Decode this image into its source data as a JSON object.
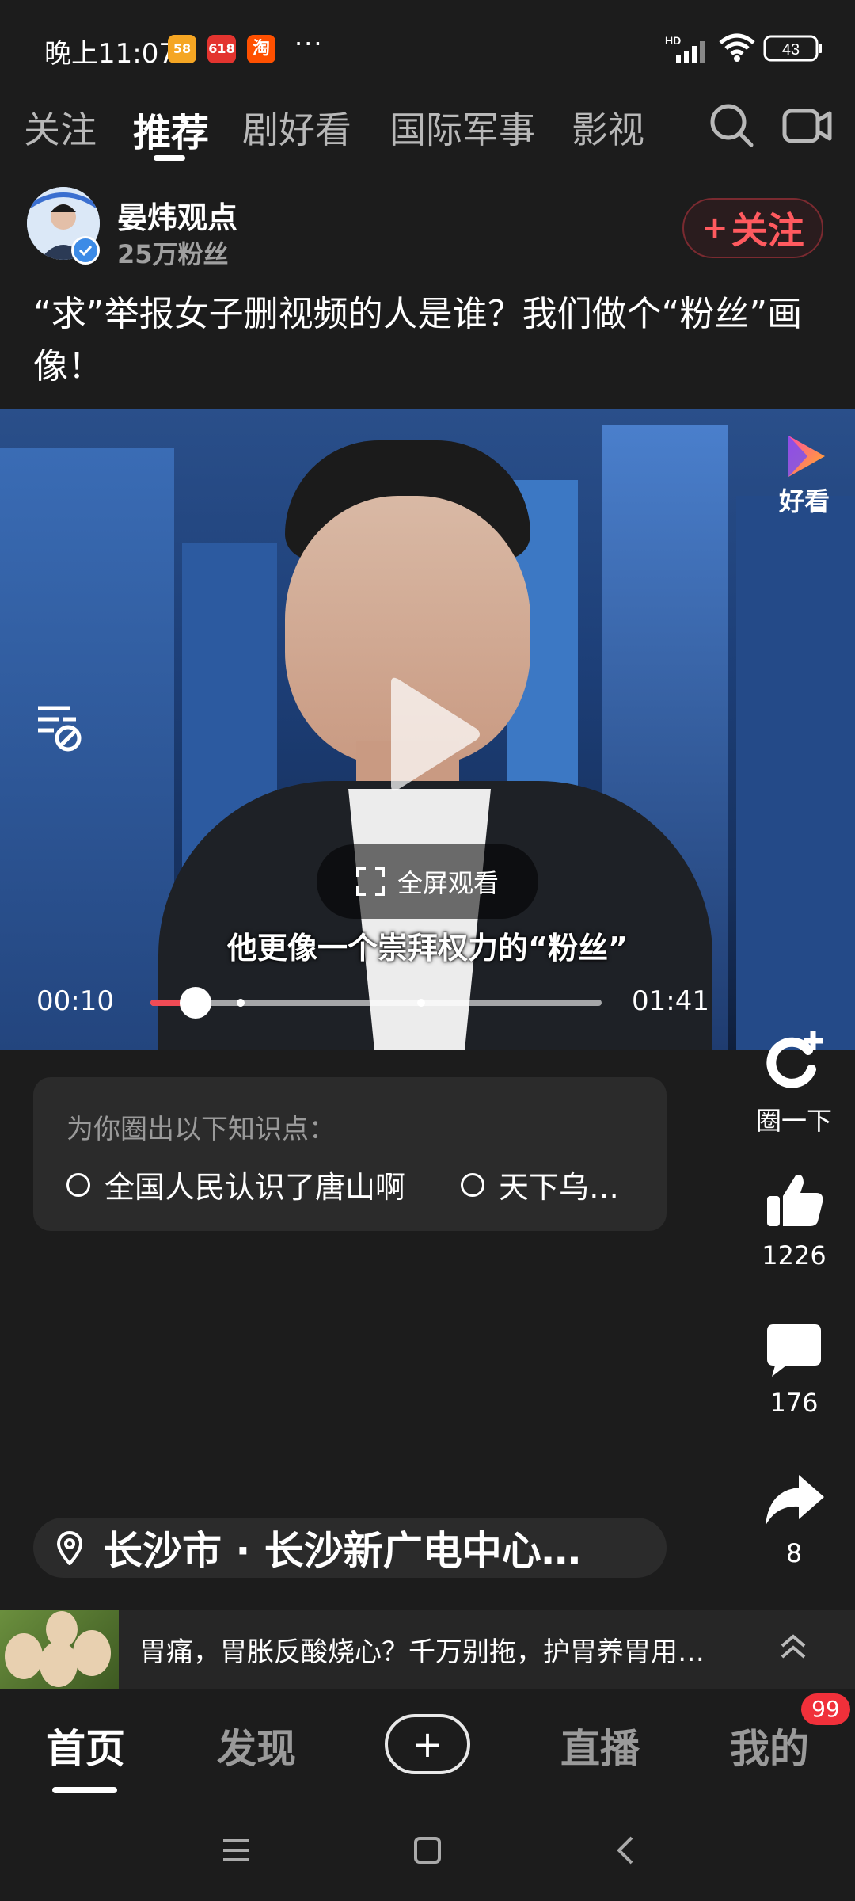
{
  "status_bar": {
    "time": "晚上11:07",
    "apps": [
      "58",
      "618",
      "淘"
    ],
    "more": "···",
    "network": "HD",
    "battery": "43"
  },
  "top_nav": {
    "tabs": [
      {
        "label": "关注",
        "active": false
      },
      {
        "label": "推荐",
        "active": true
      },
      {
        "label": "剧好看",
        "active": false
      },
      {
        "label": "国际军事",
        "active": false
      },
      {
        "label": "影视",
        "active": false
      }
    ],
    "icons": [
      "search-icon",
      "video-camera-icon"
    ]
  },
  "author": {
    "name": "晏炜观点",
    "fans": "25万粉丝",
    "follow_label": "关注",
    "follow_plus": "+"
  },
  "post": {
    "title": "“求”举报女子删视频的人是谁？我们做个“粉丝”画像！"
  },
  "video": {
    "brand": "好看",
    "fullscreen_label": "全屏观看",
    "subtitle": "他更像一个崇拜权力的“粉丝”",
    "current_time": "00:10",
    "total_time": "01:41",
    "progress_fraction": 0.1,
    "marker_fractions": [
      0.2,
      0.6
    ]
  },
  "side_actions": {
    "circle_label": "圈一下",
    "likes": "1226",
    "comments": "176",
    "shares": "8"
  },
  "knowledge": {
    "title": "为你圈出以下知识点：",
    "items": [
      "全国人民认识了唐山啊",
      "天下乌…"
    ]
  },
  "location": {
    "text": "长沙市 · 长沙新广电中心…"
  },
  "ad": {
    "text": "胃痛，胃胀反酸烧心？千万别拖，护胃养胃用…"
  },
  "bottom_nav": {
    "items": [
      {
        "label": "首页",
        "active": true
      },
      {
        "label": "发现",
        "active": false
      },
      {
        "label": "+",
        "active": false
      },
      {
        "label": "直播",
        "active": false
      },
      {
        "label": "我的",
        "active": false
      }
    ],
    "badge": "99"
  },
  "colors": {
    "accent_red": "#ff5a5f",
    "badge_red": "#f0303a",
    "background": "#1c1c1c",
    "card": "#2b2b2b"
  }
}
